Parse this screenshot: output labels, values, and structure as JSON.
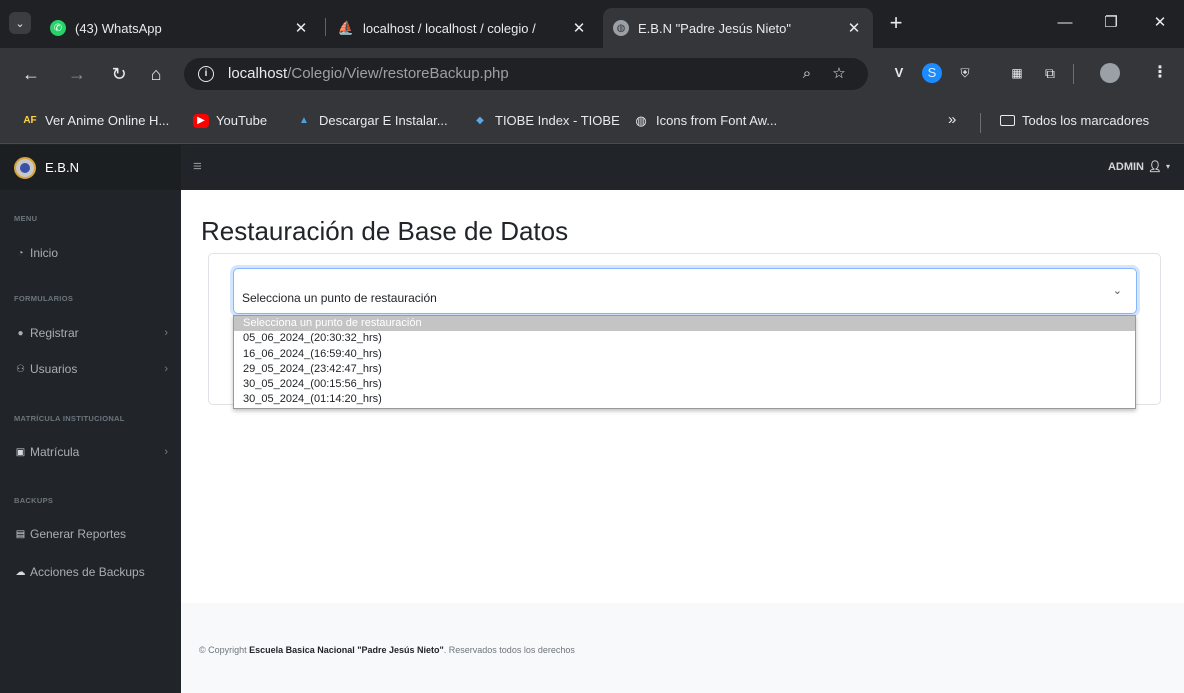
{
  "browser": {
    "tabs": [
      {
        "title": "(43) WhatsApp",
        "active": false
      },
      {
        "title": "localhost / localhost / colegio /",
        "active": false
      },
      {
        "title": "E.B.N \"Padre Jesús Nieto\"",
        "active": true
      }
    ],
    "url_host": "localhost",
    "url_path": "/Colegio/View/restoreBackup.php",
    "bookmarks": [
      {
        "label": "Ver Anime Online H...",
        "icon": "af-icon",
        "icon_text": "AF"
      },
      {
        "label": "YouTube",
        "icon": "youtube-icon"
      },
      {
        "label": "Descargar E Instalar...",
        "icon": "download-icon"
      },
      {
        "label": "TIOBE Index - TIOBE",
        "icon": "tiobe-icon"
      },
      {
        "label": "Icons from Font Aw...",
        "icon": "globe-icon"
      }
    ],
    "all_bookmarks_label": "Todos los marcadores",
    "more_bookmarks": "»"
  },
  "app": {
    "brand": "E.B.N",
    "user_menu": "ADMIN",
    "sidebar": {
      "sections": [
        {
          "heading": "MENU",
          "items": [
            {
              "label": "Inicio",
              "icon": "dashboard-icon",
              "has_children": false
            }
          ]
        },
        {
          "heading": "FORMULARIOS",
          "items": [
            {
              "label": "Registrar",
              "icon": "user-icon",
              "has_children": true
            },
            {
              "label": "Usuarios",
              "icon": "users-icon",
              "has_children": true
            }
          ]
        },
        {
          "heading": "MATRÍCULA INSTITUCIONAL",
          "items": [
            {
              "label": "Matrícula",
              "icon": "clipboard-icon",
              "has_children": true
            }
          ]
        },
        {
          "heading": "BACKUPS",
          "items": [
            {
              "label": "Generar Reportes",
              "icon": "report-icon",
              "has_children": false
            },
            {
              "label": "Acciones de Backups",
              "icon": "cloud-icon",
              "has_children": false
            }
          ]
        }
      ]
    },
    "page_title": "Restauración de Base de Datos",
    "restore_select": {
      "selected": "Selecciona un punto de restauración",
      "options": [
        "Selecciona un punto de restauración",
        "05_06_2024_(20:30:32_hrs)",
        "16_06_2024_(16:59:40_hrs)",
        "29_05_2024_(23:42:47_hrs)",
        "30_05_2024_(00:15:56_hrs)",
        "30_05_2024_(01:14:20_hrs)"
      ]
    },
    "footer": {
      "prefix": "© Copyright ",
      "org": "Escuela Basica Nacional \"Padre Jesús Nieto\"",
      "suffix": ". Reservados todos los derechos"
    }
  },
  "colors": {
    "sidebar_bg": "#212529",
    "focus_border": "#86b7fe",
    "selected_option_bg": "#c4c4c4"
  }
}
